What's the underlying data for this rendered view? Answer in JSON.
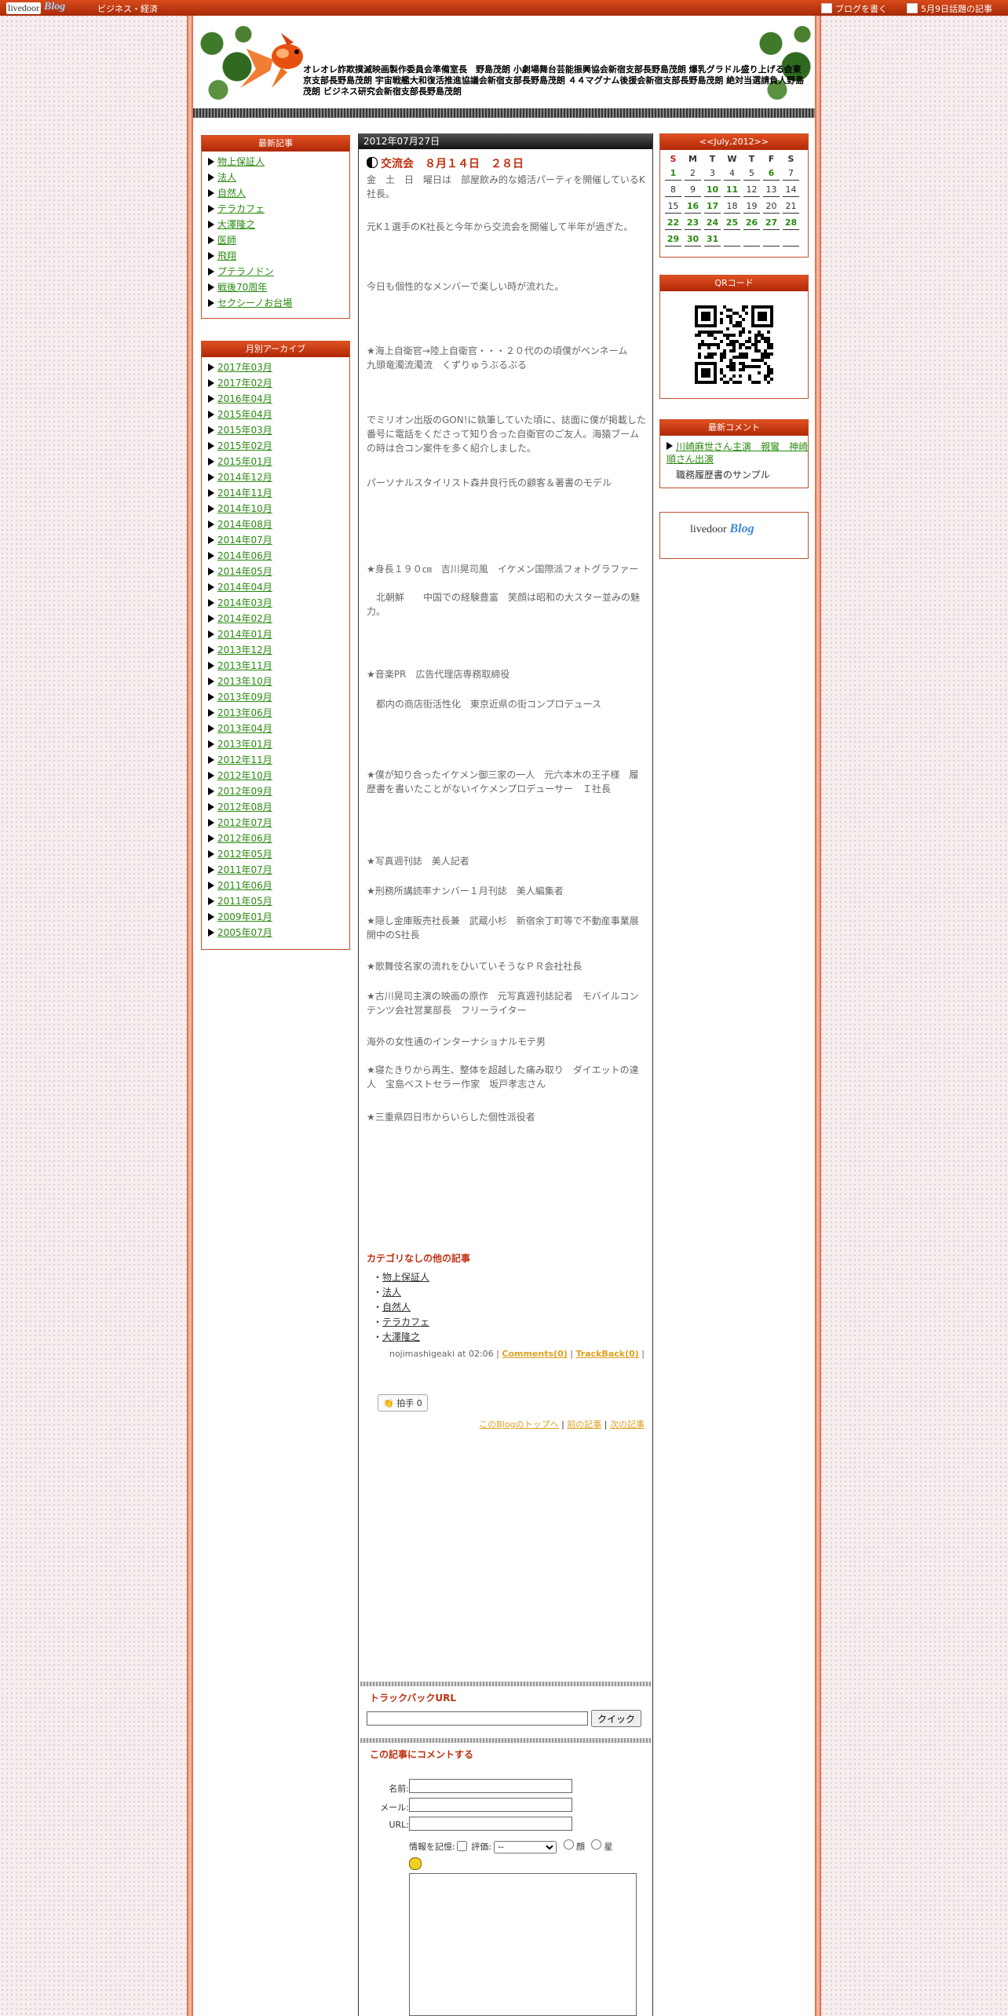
{
  "topbar": {
    "logo_text": "livedoor",
    "logo_blog": "Blog",
    "category": "ビジネス・経済",
    "write_blog": "ブログを書く",
    "topic_article": "5月9日話題の記事"
  },
  "header": {
    "blog_title": "オレオレ詐欺撲滅映画製作委員会準備室長　野島茂朗 小劇場舞台芸能振興協会新宿支部長野島茂朗 爆乳グラドル盛り上げる会東京支部長野島茂朗 宇宙戦艦大和復活推進協議会新宿支部長野島茂朗 ４４マグナム後援会新宿支部長野島茂朗 絶対当選請負人野島茂朗 ビジネス研究会新宿支部長野島茂朗"
  },
  "recent": {
    "title": "最新記事",
    "items": [
      "物上保証人",
      "法人",
      "自然人",
      "テラカフェ",
      "大澤隆之",
      "医師",
      "飛翔",
      "プテラノドン",
      "戦後70周年",
      "セクシーノお台場"
    ]
  },
  "archive": {
    "title": "月別アーカイブ",
    "items": [
      "2017年03月",
      "2017年02月",
      "2016年04月",
      "2015年04月",
      "2015年03月",
      "2015年02月",
      "2015年01月",
      "2014年12月",
      "2014年11月",
      "2014年10月",
      "2014年08月",
      "2014年07月",
      "2014年06月",
      "2014年05月",
      "2014年04月",
      "2014年03月",
      "2014年02月",
      "2014年01月",
      "2013年12月",
      "2013年11月",
      "2013年10月",
      "2013年09月",
      "2013年06月",
      "2013年04月",
      "2013年01月",
      "2012年11月",
      "2012年10月",
      "2012年09月",
      "2012年08月",
      "2012年07月",
      "2012年06月",
      "2012年05月",
      "2011年07月",
      "2011年06月",
      "2011年05月",
      "2009年01月",
      "2005年07月"
    ]
  },
  "post": {
    "date": "2012年07月27日",
    "title": "交流会　８月１４日　２８日",
    "paragraphs": [
      "金　土　日　曜日は　部屋飲み的な婚活パーティを開催しているK社長。",
      "元K１選手のK社長と今年から交流会を開催して半年が過ぎた。",
      "今日も個性的なメンバーで楽しい時が流れた。",
      "★海上自衛官→陸上自衛官・・・２０代のの頃僕がペンネーム　九頭竜濁流濁流　くずりゅうぶるぶる",
      "でミリオン出版のGON!に執筆していた頃に、誌面に僕が掲載した番号に電話をくださって知り合った自衛官のご友人。海猿ブームの時は合コン案件を多く紹介しました。",
      "パーソナルスタイリスト森井良行氏の顧客＆著書のモデル",
      "★身長１９０㎝　吉川晃司風　イケメン国際派フォトグラファー",
      "　北朝鮮　　中国での経験豊富　笑顔は昭和の大スター並みの魅力。",
      "★音楽PR　広告代理店専務取締役",
      "　都内の商店街活性化　東京近県の街コンプロデュース",
      "★僕が知り合ったイケメン御三家の一人　元六本木の王子様　履歴書を書いたことがないイケメンプロデューサー　Ｉ社長",
      "★写真週刊誌　美人記者",
      "★刑務所講読率ナンバー１月刊誌　美人編集者",
      "★隠し金庫販売社長兼　武蔵小杉　新宿余丁町等で不動産事業展開中のS社長",
      "★歌舞伎名家の流れをひいていそうなＰＲ会社社長",
      "★古川晃司主演の映画の原作　元写真週刊誌記者　モバイルコンテンツ会社営業部長　フリーライター",
      "海外の女性通のインターナショナルモテ男",
      "★寝たきりから再生、整体を超越した痛み取り　ダイエットの達人　宝島ベストセラー作家　坂戸孝志さん",
      "★三重県四日市からいらした個性派役者"
    ],
    "related_title": "カテゴリなしの他の記事",
    "related": [
      "物上保証人",
      "法人",
      "自然人",
      "テラカフェ",
      "大澤隆之"
    ],
    "footer_author": "nojimashigeaki at 02:06",
    "comments_link": "Comments(0)",
    "trackback_link": "TrackBack(0)",
    "clap_label": "拍手",
    "clap_count": "0",
    "nav_top": "このBlogのトップへ",
    "nav_prev": "前の記事",
    "nav_next": "次の記事"
  },
  "trackback": {
    "title": "トラックバックURL",
    "button": "クイック"
  },
  "comment_form": {
    "title": "この記事にコメントする",
    "name_label": "名前:",
    "mail_label": "メール:",
    "url_label": "URL:",
    "remember_label": "情報を記憶:",
    "rating_label": "評価:",
    "rating_value": "--",
    "face_label": "顔",
    "star_label": "星"
  },
  "calendar": {
    "title": "<<July,2012>>",
    "weekdays": [
      "S",
      "M",
      "T",
      "W",
      "T",
      "F",
      "S"
    ],
    "rows": [
      [
        "1",
        "2",
        "3",
        "4",
        "5",
        "6",
        "7"
      ],
      [
        "8",
        "9",
        "10",
        "11",
        "12",
        "13",
        "14"
      ],
      [
        "15",
        "16",
        "17",
        "18",
        "19",
        "20",
        "21"
      ],
      [
        "22",
        "23",
        "24",
        "25",
        "26",
        "27",
        "28"
      ],
      [
        "29",
        "30",
        "31",
        "",
        "",
        "",
        ""
      ]
    ],
    "linked_days": [
      "1",
      "6",
      "10",
      "11",
      "16",
      "17",
      "22",
      "23",
      "24",
      "25",
      "26",
      "27",
      "28",
      "29",
      "30",
      "31"
    ]
  },
  "qr": {
    "title": "QRコード"
  },
  "recent_comments": {
    "title": "最新コメント",
    "link": "川崎麻世さん主演　親鸞　神崎順さん出演",
    "source": "職務履歴書のサンプル"
  },
  "livedoor_badge": {
    "text": "livedoor",
    "blog": "Blog"
  },
  "colors": {
    "accent": "#c03010",
    "link": "#2a8a10",
    "header_bar": "#b02808"
  }
}
